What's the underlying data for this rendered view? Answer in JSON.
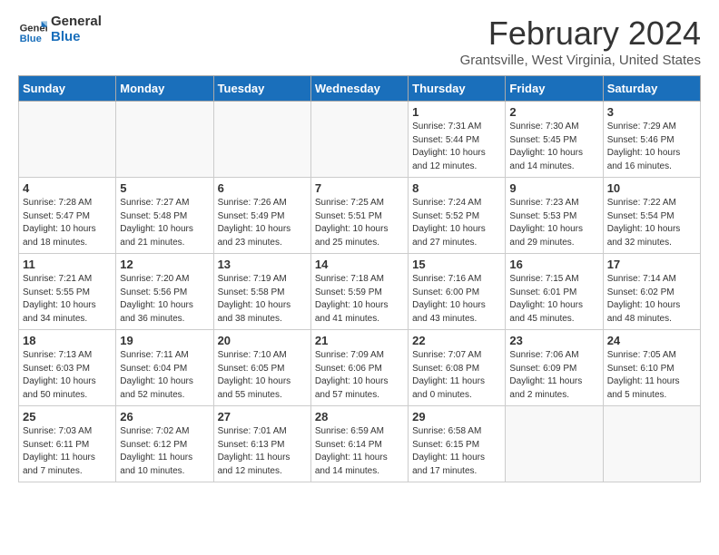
{
  "header": {
    "logo_line1": "General",
    "logo_line2": "Blue",
    "month": "February 2024",
    "location": "Grantsville, West Virginia, United States"
  },
  "days_of_week": [
    "Sunday",
    "Monday",
    "Tuesday",
    "Wednesday",
    "Thursday",
    "Friday",
    "Saturday"
  ],
  "weeks": [
    [
      {
        "num": "",
        "info": ""
      },
      {
        "num": "",
        "info": ""
      },
      {
        "num": "",
        "info": ""
      },
      {
        "num": "",
        "info": ""
      },
      {
        "num": "1",
        "info": "Sunrise: 7:31 AM\nSunset: 5:44 PM\nDaylight: 10 hours\nand 12 minutes."
      },
      {
        "num": "2",
        "info": "Sunrise: 7:30 AM\nSunset: 5:45 PM\nDaylight: 10 hours\nand 14 minutes."
      },
      {
        "num": "3",
        "info": "Sunrise: 7:29 AM\nSunset: 5:46 PM\nDaylight: 10 hours\nand 16 minutes."
      }
    ],
    [
      {
        "num": "4",
        "info": "Sunrise: 7:28 AM\nSunset: 5:47 PM\nDaylight: 10 hours\nand 18 minutes."
      },
      {
        "num": "5",
        "info": "Sunrise: 7:27 AM\nSunset: 5:48 PM\nDaylight: 10 hours\nand 21 minutes."
      },
      {
        "num": "6",
        "info": "Sunrise: 7:26 AM\nSunset: 5:49 PM\nDaylight: 10 hours\nand 23 minutes."
      },
      {
        "num": "7",
        "info": "Sunrise: 7:25 AM\nSunset: 5:51 PM\nDaylight: 10 hours\nand 25 minutes."
      },
      {
        "num": "8",
        "info": "Sunrise: 7:24 AM\nSunset: 5:52 PM\nDaylight: 10 hours\nand 27 minutes."
      },
      {
        "num": "9",
        "info": "Sunrise: 7:23 AM\nSunset: 5:53 PM\nDaylight: 10 hours\nand 29 minutes."
      },
      {
        "num": "10",
        "info": "Sunrise: 7:22 AM\nSunset: 5:54 PM\nDaylight: 10 hours\nand 32 minutes."
      }
    ],
    [
      {
        "num": "11",
        "info": "Sunrise: 7:21 AM\nSunset: 5:55 PM\nDaylight: 10 hours\nand 34 minutes."
      },
      {
        "num": "12",
        "info": "Sunrise: 7:20 AM\nSunset: 5:56 PM\nDaylight: 10 hours\nand 36 minutes."
      },
      {
        "num": "13",
        "info": "Sunrise: 7:19 AM\nSunset: 5:58 PM\nDaylight: 10 hours\nand 38 minutes."
      },
      {
        "num": "14",
        "info": "Sunrise: 7:18 AM\nSunset: 5:59 PM\nDaylight: 10 hours\nand 41 minutes."
      },
      {
        "num": "15",
        "info": "Sunrise: 7:16 AM\nSunset: 6:00 PM\nDaylight: 10 hours\nand 43 minutes."
      },
      {
        "num": "16",
        "info": "Sunrise: 7:15 AM\nSunset: 6:01 PM\nDaylight: 10 hours\nand 45 minutes."
      },
      {
        "num": "17",
        "info": "Sunrise: 7:14 AM\nSunset: 6:02 PM\nDaylight: 10 hours\nand 48 minutes."
      }
    ],
    [
      {
        "num": "18",
        "info": "Sunrise: 7:13 AM\nSunset: 6:03 PM\nDaylight: 10 hours\nand 50 minutes."
      },
      {
        "num": "19",
        "info": "Sunrise: 7:11 AM\nSunset: 6:04 PM\nDaylight: 10 hours\nand 52 minutes."
      },
      {
        "num": "20",
        "info": "Sunrise: 7:10 AM\nSunset: 6:05 PM\nDaylight: 10 hours\nand 55 minutes."
      },
      {
        "num": "21",
        "info": "Sunrise: 7:09 AM\nSunset: 6:06 PM\nDaylight: 10 hours\nand 57 minutes."
      },
      {
        "num": "22",
        "info": "Sunrise: 7:07 AM\nSunset: 6:08 PM\nDaylight: 11 hours\nand 0 minutes."
      },
      {
        "num": "23",
        "info": "Sunrise: 7:06 AM\nSunset: 6:09 PM\nDaylight: 11 hours\nand 2 minutes."
      },
      {
        "num": "24",
        "info": "Sunrise: 7:05 AM\nSunset: 6:10 PM\nDaylight: 11 hours\nand 5 minutes."
      }
    ],
    [
      {
        "num": "25",
        "info": "Sunrise: 7:03 AM\nSunset: 6:11 PM\nDaylight: 11 hours\nand 7 minutes."
      },
      {
        "num": "26",
        "info": "Sunrise: 7:02 AM\nSunset: 6:12 PM\nDaylight: 11 hours\nand 10 minutes."
      },
      {
        "num": "27",
        "info": "Sunrise: 7:01 AM\nSunset: 6:13 PM\nDaylight: 11 hours\nand 12 minutes."
      },
      {
        "num": "28",
        "info": "Sunrise: 6:59 AM\nSunset: 6:14 PM\nDaylight: 11 hours\nand 14 minutes."
      },
      {
        "num": "29",
        "info": "Sunrise: 6:58 AM\nSunset: 6:15 PM\nDaylight: 11 hours\nand 17 minutes."
      },
      {
        "num": "",
        "info": ""
      },
      {
        "num": "",
        "info": ""
      }
    ]
  ]
}
